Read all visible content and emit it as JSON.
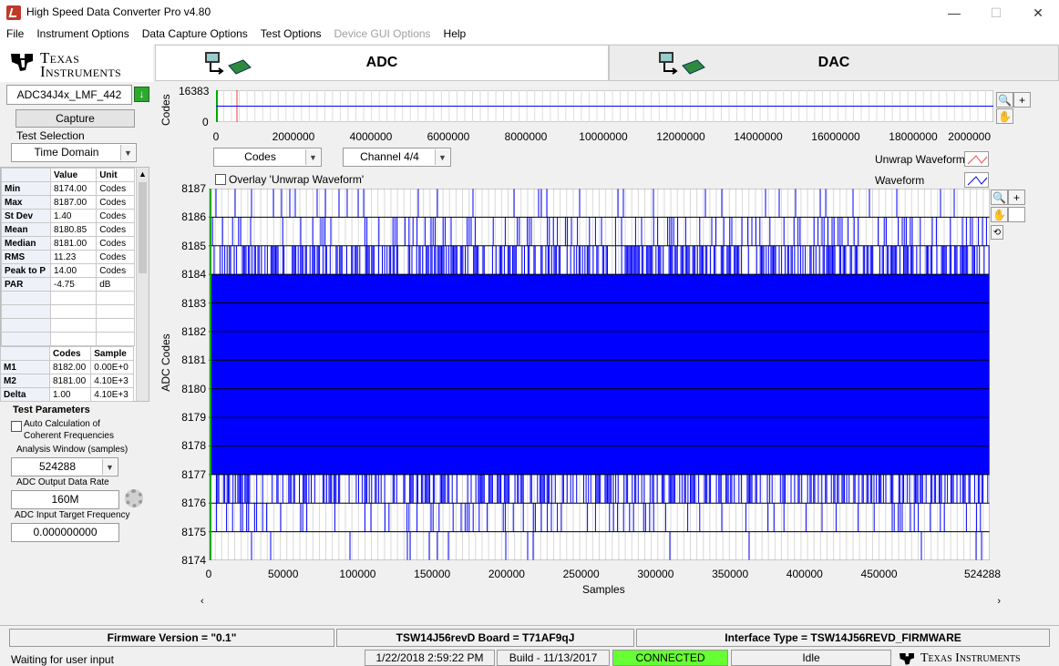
{
  "window": {
    "title": "High Speed Data Converter Pro v4.80",
    "minimize": "—",
    "maximize": "☐",
    "close": "✕"
  },
  "menu": [
    "File",
    "Instrument Options",
    "Data Capture Options",
    "Test Options",
    "Device GUI Options",
    "Help"
  ],
  "menu_disabled": [
    false,
    false,
    false,
    false,
    true,
    false
  ],
  "logo": {
    "line1": "Texas",
    "line2": "Instruments"
  },
  "tabs": {
    "adc": "ADC",
    "dac": "DAC"
  },
  "left": {
    "device": "ADC34J4x_LMF_442",
    "capture": "Capture",
    "test_selection_label": "Test Selection",
    "test_selection": "Time Domain",
    "stats_header": [
      "",
      "Value",
      "Unit"
    ],
    "stats": [
      [
        "Min",
        "8174.00",
        "Codes"
      ],
      [
        "Max",
        "8187.00",
        "Codes"
      ],
      [
        "St Dev",
        "1.40",
        "Codes"
      ],
      [
        "Mean",
        "8180.85",
        "Codes"
      ],
      [
        "Median",
        "8181.00",
        "Codes"
      ],
      [
        "RMS",
        "11.23",
        "Codes"
      ],
      [
        "Peak to P",
        "14.00",
        "Codes"
      ],
      [
        "PAR",
        "-4.75",
        "dB"
      ],
      [
        "",
        "",
        ""
      ],
      [
        "",
        "",
        ""
      ],
      [
        "",
        "",
        ""
      ],
      [
        "",
        "",
        ""
      ]
    ],
    "marker_header": [
      "",
      "Codes",
      "Sample"
    ],
    "markers": [
      [
        "M1",
        "8182.00",
        "0.00E+0"
      ],
      [
        "M2",
        "8181.00",
        "4.10E+3"
      ],
      [
        "Delta",
        "1.00",
        "4.10E+3"
      ]
    ],
    "test_params_label": "Test Parameters",
    "auto_calc_label": "Auto Calculation of Coherent Frequencies",
    "analysis_window_label": "Analysis Window (samples)",
    "analysis_window": "524288",
    "output_rate_label": "ADC Output Data Rate",
    "output_rate": "160M",
    "input_freq_label": "ADC Input Target Frequency",
    "input_freq": "0.000000000"
  },
  "overview": {
    "ylabel": "Codes",
    "y_ticks": [
      "16383",
      "0"
    ],
    "x_ticks": [
      "0",
      "2000000",
      "4000000",
      "6000000",
      "8000000",
      "10000000",
      "12000000",
      "14000000",
      "16000000",
      "18000000",
      "2000000"
    ]
  },
  "controls": {
    "units": "Codes",
    "channel": "Channel 4/4",
    "overlay_label": "Overlay 'Unwrap Waveform'",
    "legend_unwrap": "Unwrap Waveform",
    "legend_waveform": "Waveform"
  },
  "colors": {
    "waveform": "#0000ff",
    "unwrap": "#ff3333",
    "connected": "#66ff33",
    "cursor": "#00aa00"
  },
  "chart_data": {
    "type": "line",
    "xlabel": "Samples",
    "ylabel": "ADC Codes",
    "xlim": [
      0,
      524288
    ],
    "ylim": [
      8174,
      8187
    ],
    "x_ticks": [
      "0",
      "50000",
      "100000",
      "150000",
      "200000",
      "250000",
      "300000",
      "350000",
      "400000",
      "450000",
      "524288"
    ],
    "y_ticks": [
      "8187",
      "8186",
      "8185",
      "8184",
      "8183",
      "8182",
      "8181",
      "8180",
      "8179",
      "8178",
      "8177",
      "8176",
      "8175",
      "8174"
    ],
    "dense_band": [
      8177,
      8184
    ],
    "frequent_band": [
      8176,
      8185
    ],
    "occasional_band": [
      8175,
      8186
    ],
    "series": [
      {
        "name": "Waveform",
        "min": 8174,
        "max": 8187,
        "mean": 8180.85
      }
    ],
    "grid": true
  },
  "status": {
    "firmware": "Firmware Version = \"0.1\"",
    "board": "TSW14J56revD Board = T71AF9qJ",
    "interface": "Interface Type = TSW14J56REVD_FIRMWARE",
    "message": "Waiting for user input",
    "datetime": "1/22/2018 2:59:22 PM",
    "build": "Build  - 11/13/2017",
    "connected": "CONNECTED",
    "idle": "Idle",
    "brand": "Texas Instruments"
  }
}
